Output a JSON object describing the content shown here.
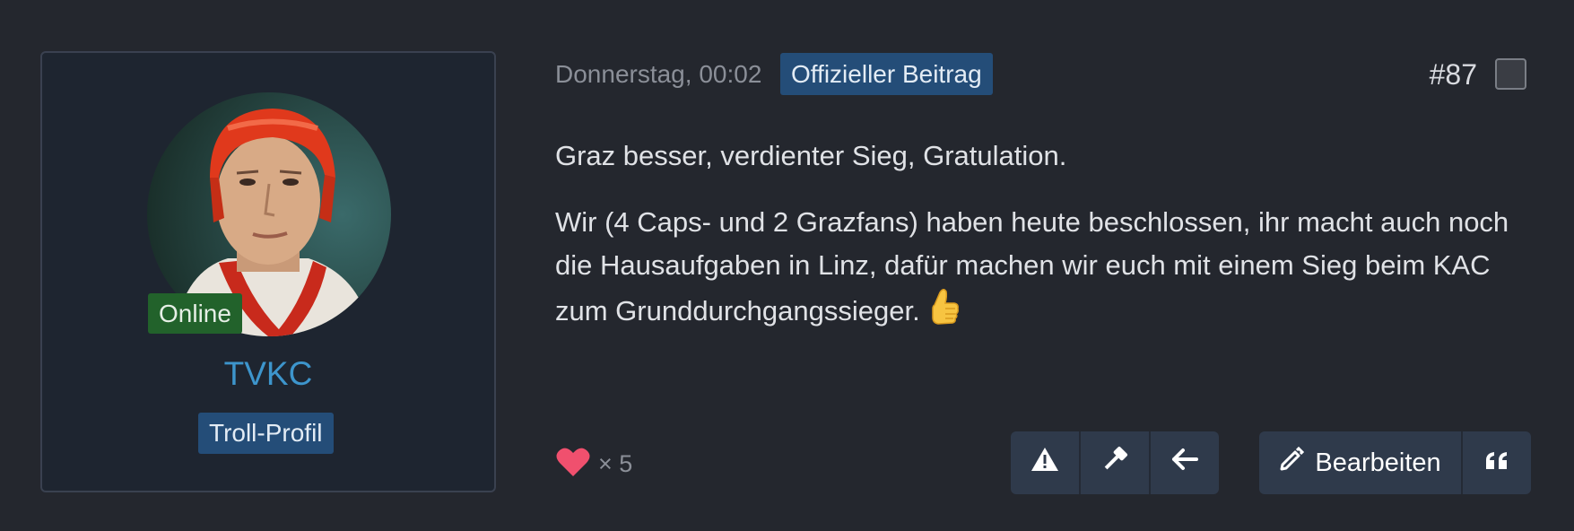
{
  "author": {
    "status": "Online",
    "username": "TVKC",
    "rank": "Troll-Profil"
  },
  "post": {
    "date": "Donnerstag, 00:02",
    "badge": "Offizieller Beitrag",
    "number": "#87",
    "paragraphs": [
      "Graz besser, verdienter Sieg, Gratulation.",
      "Wir (4 Caps- und 2 Grazfans) haben heute beschlossen, ihr macht auch noch die Hausaufgaben in Linz, dafür machen wir euch mit einem Sieg beim KAC zum Grunddurchgangssieger."
    ],
    "emoji": "thumbs-up-icon"
  },
  "reactions": {
    "icon": "heart-icon",
    "count_label": "× 5"
  },
  "actions": {
    "report_icon": "warning-icon",
    "moderate_icon": "gavel-icon",
    "reply_icon": "arrow-left-icon",
    "edit_label": "Bearbeiten",
    "quote_icon": "quote-icon"
  },
  "colors": {
    "accent": "#3d95cc",
    "badge": "#244d78",
    "online": "#22622b",
    "heart": "#f0506e"
  }
}
